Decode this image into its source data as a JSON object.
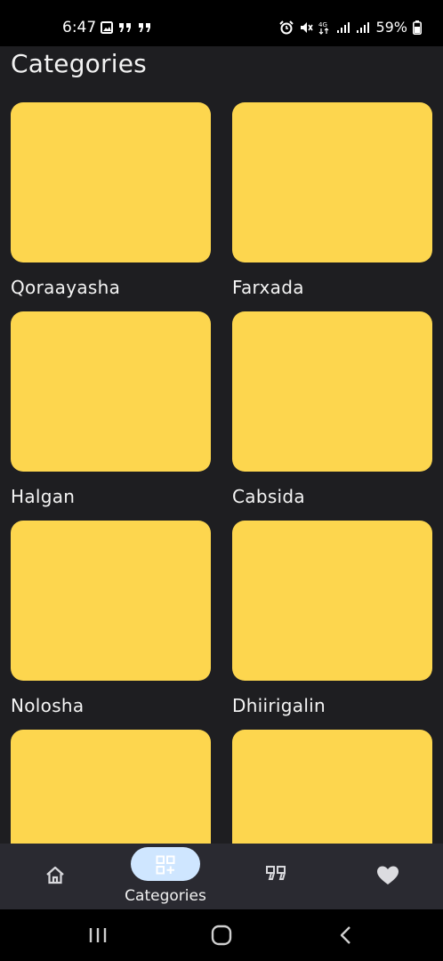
{
  "status_bar": {
    "time": "6:47",
    "battery": "59%",
    "network": "4G"
  },
  "page": {
    "title": "Categories"
  },
  "categories": [
    {
      "label": "Qoraayasha"
    },
    {
      "label": "Farxada"
    },
    {
      "label": "Halgan"
    },
    {
      "label": "Cabsida"
    },
    {
      "label": "Nolosha"
    },
    {
      "label": "Dhiirigalin"
    },
    {
      "label": ""
    },
    {
      "label": ""
    }
  ],
  "bottom_nav": {
    "items": [
      {
        "label": "",
        "icon": "home-icon"
      },
      {
        "label": "Categories",
        "icon": "categories-icon",
        "active": true
      },
      {
        "label": "",
        "icon": "quote-icon"
      },
      {
        "label": "",
        "icon": "heart-icon"
      }
    ]
  },
  "colors": {
    "background": "#1e1e21",
    "card": "#fdd64e",
    "nav_background": "#2a2a31",
    "active_pill": "#cfe6ff"
  }
}
